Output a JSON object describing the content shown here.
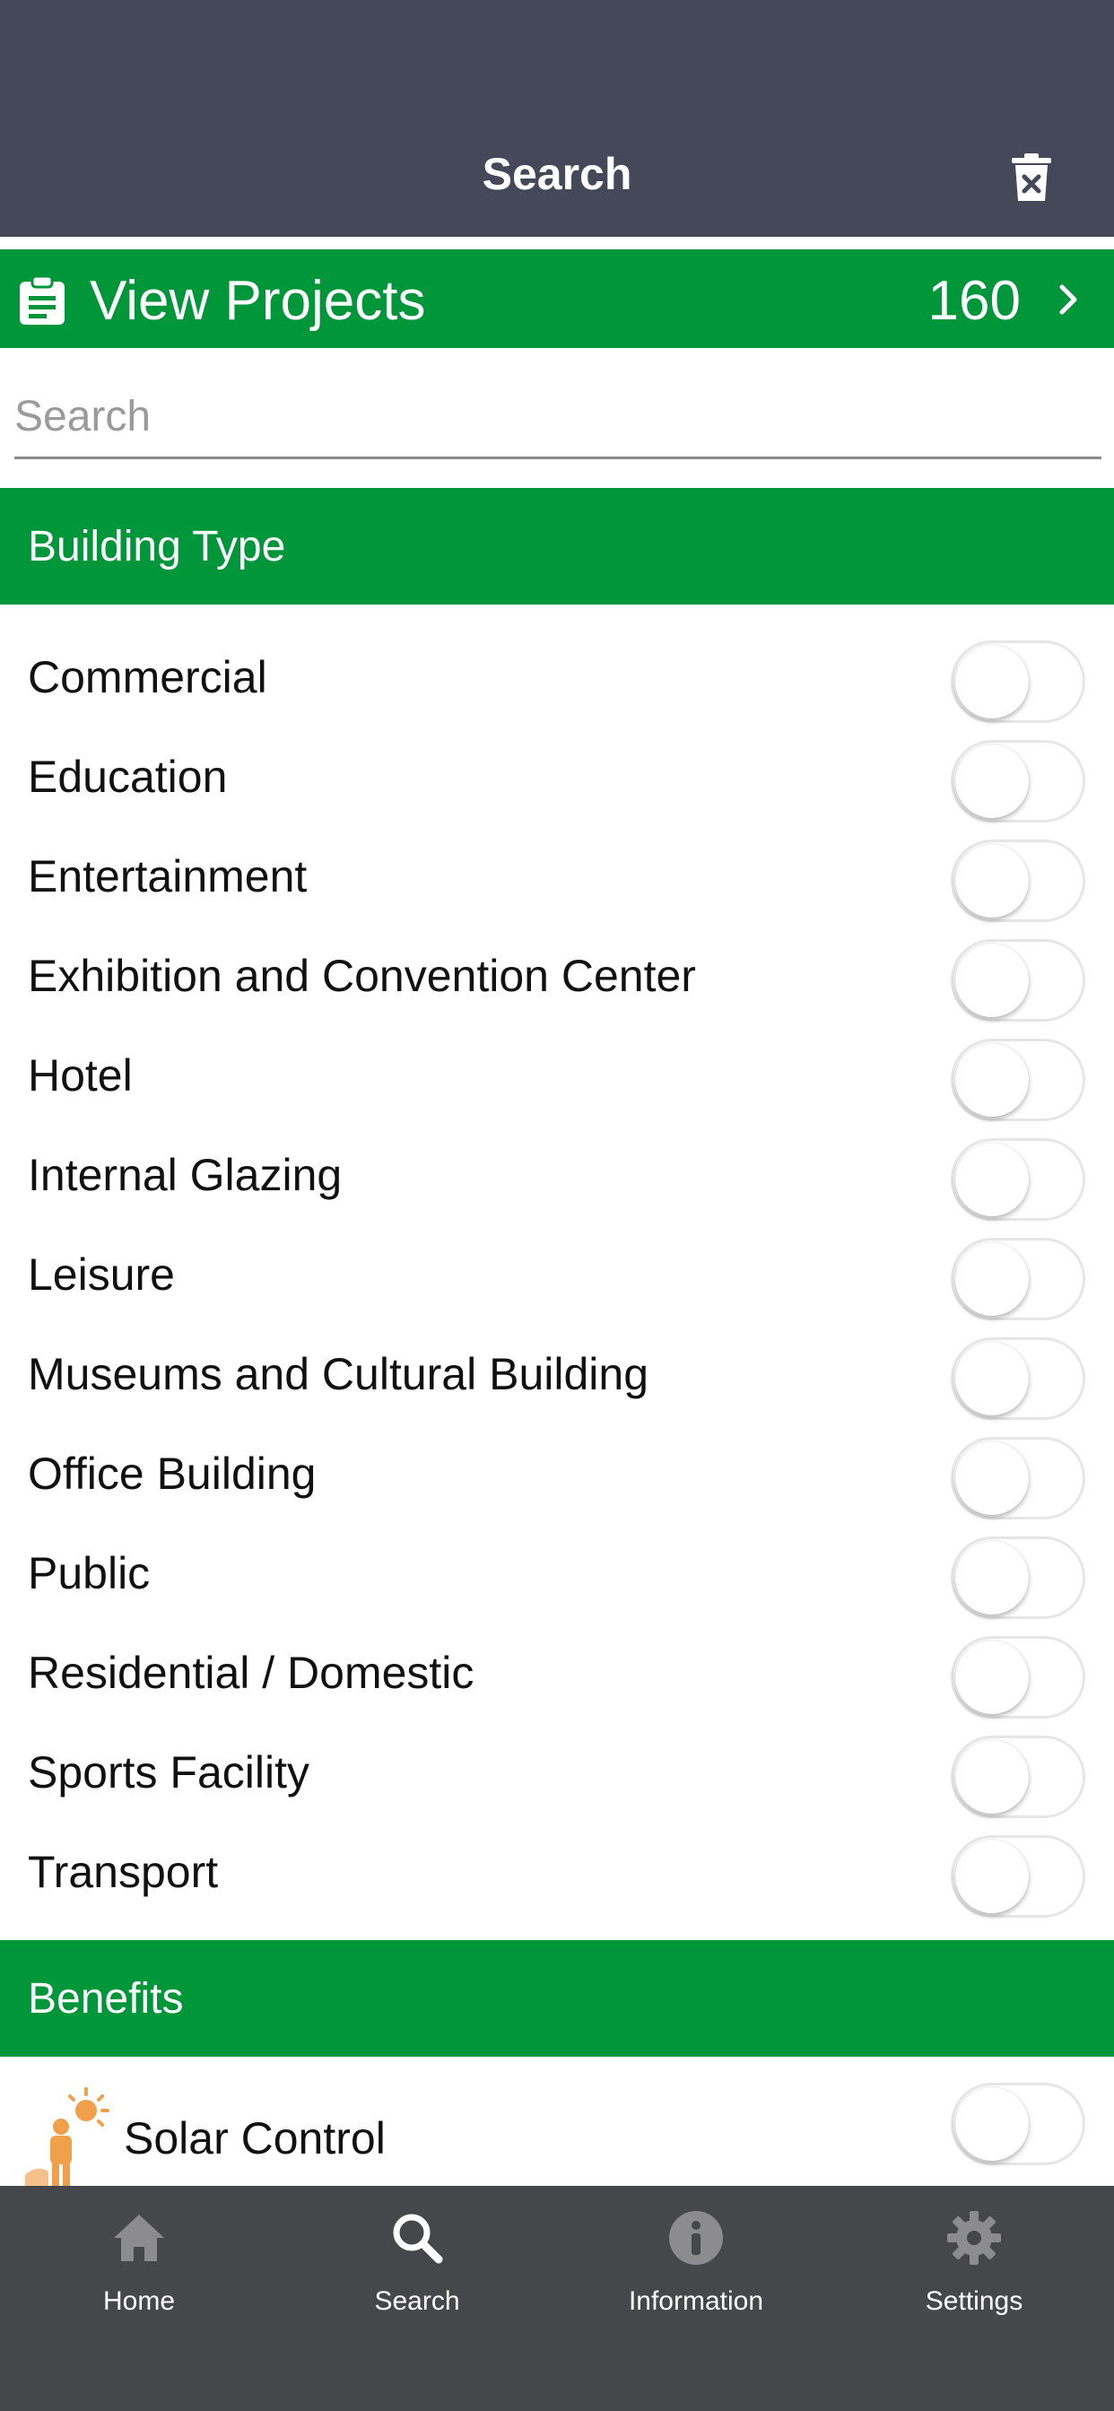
{
  "header": {
    "title": "Search",
    "trash_icon": "trash-icon"
  },
  "view_projects": {
    "label": "View Projects",
    "count": "160",
    "icon": "clipboard-icon",
    "chevron": "chevron-right-icon"
  },
  "search": {
    "placeholder": "Search",
    "value": ""
  },
  "building_type": {
    "title": "Building Type",
    "items": [
      {
        "label": "Commercial",
        "enabled": false
      },
      {
        "label": "Education",
        "enabled": false
      },
      {
        "label": "Entertainment",
        "enabled": false
      },
      {
        "label": "Exhibition and Convention Center",
        "enabled": false
      },
      {
        "label": "Hotel",
        "enabled": false
      },
      {
        "label": "Internal Glazing",
        "enabled": false
      },
      {
        "label": "Leisure",
        "enabled": false
      },
      {
        "label": "Museums and Cultural Building",
        "enabled": false
      },
      {
        "label": "Office Building",
        "enabled": false
      },
      {
        "label": "Public",
        "enabled": false
      },
      {
        "label": "Residential / Domestic",
        "enabled": false
      },
      {
        "label": "Sports Facility",
        "enabled": false
      },
      {
        "label": "Transport",
        "enabled": false
      }
    ]
  },
  "benefits": {
    "title": "Benefits",
    "items": [
      {
        "label": "Solar Control",
        "icon": "solar-control-icon",
        "enabled": false
      }
    ]
  },
  "tabbar": {
    "tabs": [
      {
        "label": "Home",
        "icon": "home-icon",
        "active": false
      },
      {
        "label": "Search",
        "icon": "search-icon",
        "active": true
      },
      {
        "label": "Information",
        "icon": "info-icon",
        "active": false
      },
      {
        "label": "Settings",
        "icon": "gear-icon",
        "active": false
      }
    ]
  },
  "colors": {
    "header": "#454859",
    "accent_green": "#009639",
    "tabbar": "#46474b",
    "tab_active": "#ffffff",
    "tab_inactive": "#8c8c8f"
  }
}
